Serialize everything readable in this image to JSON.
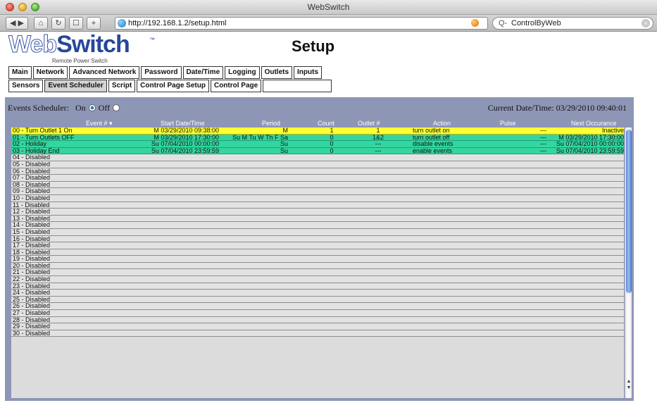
{
  "browser": {
    "window_title": "WebSwitch",
    "url": "http://192.168.1.2/setup.html",
    "search_text": "ControlByWeb",
    "search_prefix": "Q-"
  },
  "header": {
    "logo_web": "Web",
    "logo_switch": "Switch",
    "logo_tm": "™",
    "logo_subtitle": "Remote Power Switch",
    "page_title": "Setup"
  },
  "nav": {
    "row1": [
      "Main",
      "Network",
      "Advanced Network",
      "Password",
      "Date/Time",
      "Logging",
      "Outlets",
      "Inputs"
    ],
    "row2": [
      "Sensors",
      "Event Scheduler",
      "Script",
      "Control Page Setup",
      "Control Page",
      ""
    ],
    "active": "Event Scheduler"
  },
  "scheduler": {
    "label": "Events Scheduler:",
    "on_label": "On",
    "off_label": "Off",
    "selected": "On",
    "current_datetime": "Current Date/Time: 03/29/2010 09:40:01"
  },
  "columns": {
    "event": "Event # ▾",
    "start": "Start Date/Time",
    "period": "Period",
    "count": "Count",
    "outlet": "Outlet #",
    "action": "Action",
    "pulse": "Pulse",
    "next": "Next Occurance"
  },
  "events": [
    {
      "event": "00 - Turn Outlet 1 On",
      "start": "M 03/29/2010 09:38:00",
      "period": "M",
      "count": "1",
      "outlet": "1",
      "action": "turn outlet on",
      "pulse": "---",
      "next": "Inactive",
      "highlight": "yellow"
    },
    {
      "event": "01 - Turn Outlets OFF",
      "start": "M 03/29/2010 17:30:00",
      "period": "Su M Tu W Th F Sa",
      "count": "0",
      "outlet": "1&2",
      "action": "turn outlet off",
      "pulse": "---",
      "next": "M 03/29/2010 17:30:00",
      "highlight": "green"
    },
    {
      "event": "02 - Holiday",
      "start": "Su 07/04/2010 00:00:00",
      "period": "Su",
      "count": "0",
      "outlet": "---",
      "action": "disable events",
      "pulse": "---",
      "next": "Su 07/04/2010 00:00:00",
      "highlight": "green"
    },
    {
      "event": "03 - Holiday End",
      "start": "Su 07/04/2010 23:59:59",
      "period": "Su",
      "count": "0",
      "outlet": "---",
      "action": "enable events",
      "pulse": "---",
      "next": "Su 07/04/2010 23:59:59",
      "highlight": "green"
    },
    {
      "event": "04 - Disabled"
    },
    {
      "event": "05 - Disabled"
    },
    {
      "event": "06 - Disabled"
    },
    {
      "event": "07 - Disabled"
    },
    {
      "event": "08 - Disabled"
    },
    {
      "event": "09 - Disabled"
    },
    {
      "event": "10 - Disabled"
    },
    {
      "event": "11 - Disabled"
    },
    {
      "event": "12 - Disabled"
    },
    {
      "event": "13 - Disabled"
    },
    {
      "event": "14 - Disabled"
    },
    {
      "event": "15 - Disabled"
    },
    {
      "event": "16 - Disabled"
    },
    {
      "event": "17 - Disabled"
    },
    {
      "event": "18 - Disabled"
    },
    {
      "event": "19 - Disabled"
    },
    {
      "event": "20 - Disabled"
    },
    {
      "event": "21 - Disabled"
    },
    {
      "event": "22 - Disabled"
    },
    {
      "event": "23 - Disabled"
    },
    {
      "event": "24 - Disabled"
    },
    {
      "event": "25 - Disabled"
    },
    {
      "event": "26 - Disabled"
    },
    {
      "event": "27 - Disabled"
    },
    {
      "event": "28 - Disabled"
    },
    {
      "event": "29 - Disabled"
    },
    {
      "event": "30 - Disabled"
    }
  ],
  "colors": {
    "panel": "#8e96b6",
    "row_yellow": "#ffff33",
    "row_green": "#33d6a0",
    "row_disabled": "#e2e2e2",
    "logo_blue": "#27479a"
  },
  "icons": {
    "back": "back-arrow-icon",
    "forward": "forward-arrow-icon",
    "home": "home-icon",
    "reload": "reload-icon",
    "bookmark": "bookmark-icon",
    "add": "plus-icon",
    "globe": "globe-icon",
    "rss": "rss-icon",
    "search": "magnifier-icon",
    "clear": "clear-icon"
  }
}
